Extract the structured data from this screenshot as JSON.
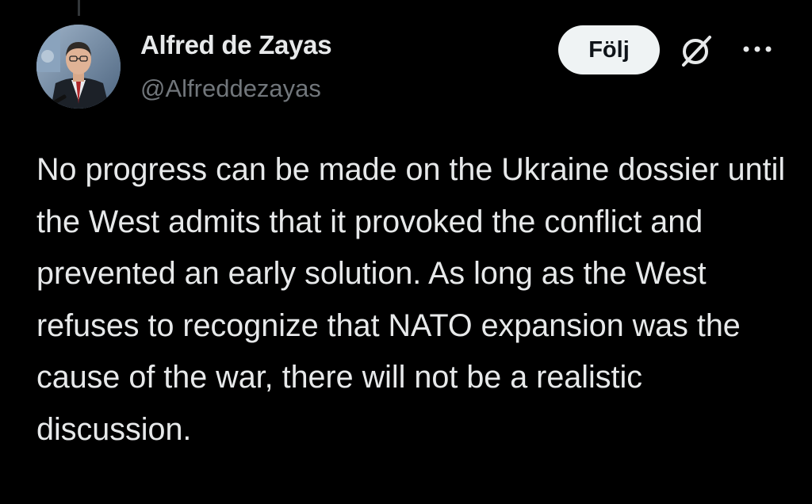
{
  "tweet": {
    "author": {
      "display_name": "Alfred de Zayas",
      "handle": "@Alfreddezayas"
    },
    "follow_label": "Följ",
    "icons": {
      "grok": "grok-icon",
      "more": "more-options-icon"
    },
    "text": "No progress can be made on the Ukraine dossier until the West admits that it provoked the conflict and prevented an early solution. As long as the West refuses to recognize that NATO expansion was the cause of the war, there will not be a realistic discussion."
  },
  "colors": {
    "background": "#000000",
    "text_primary": "#e7e9ea",
    "text_secondary": "#71767b",
    "button_bg": "#eff3f4",
    "button_text": "#0f1419"
  }
}
